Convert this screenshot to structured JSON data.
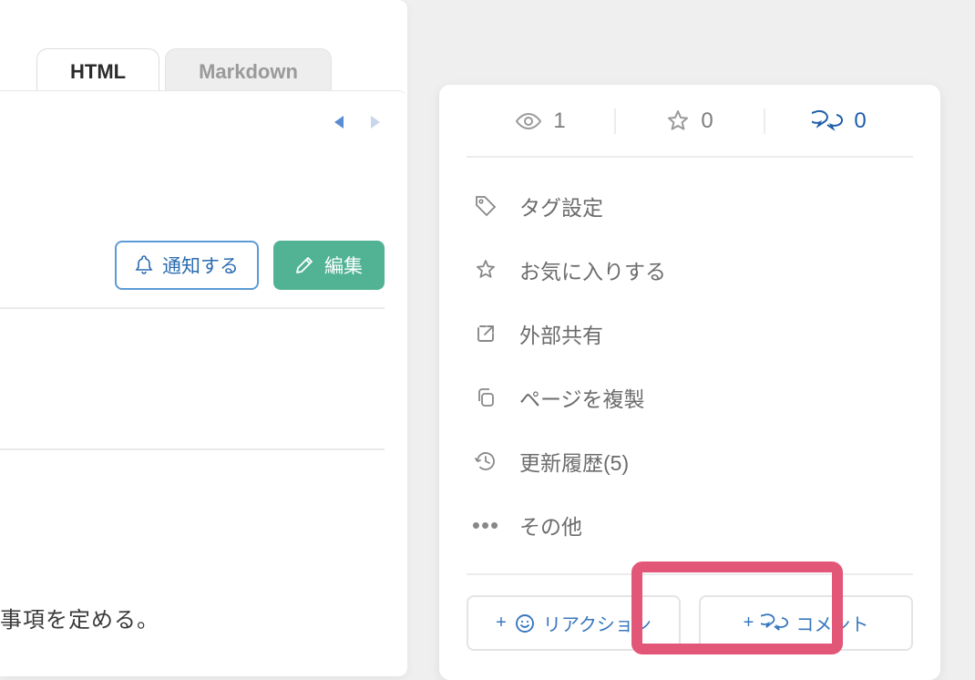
{
  "tabs": {
    "html": "HTML",
    "markdown": "Markdown"
  },
  "buttons": {
    "notify": "通知する",
    "edit": "編集"
  },
  "bodytext": "事項を定める。",
  "stats": {
    "views": "1",
    "stars": "0",
    "comments": "0"
  },
  "menu": {
    "tag": "タグ設定",
    "favorite": "お気に入りする",
    "share": "外部共有",
    "duplicate": "ページを複製",
    "history": "更新履歴(5)",
    "other": "その他"
  },
  "actions": {
    "reaction": "リアクション",
    "comment": "コメント"
  }
}
